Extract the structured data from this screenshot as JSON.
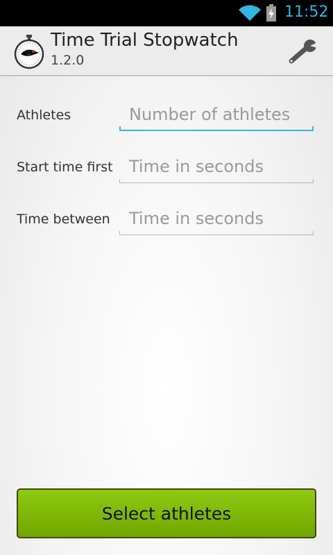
{
  "status_bar": {
    "time": "11:52",
    "icons": [
      "wifi-icon",
      "battery-charging-icon"
    ],
    "clock_color": "#33b5e5"
  },
  "action_bar": {
    "title": "Time Trial Stopwatch",
    "version": "1.2.0",
    "app_icon": "stopwatch-icon",
    "settings_icon": "wrench-icon"
  },
  "form": {
    "athletes": {
      "label": "Athletes",
      "placeholder": "Number of athletes",
      "value": ""
    },
    "start_time_first": {
      "label": "Start time first",
      "placeholder": "Time in seconds",
      "value": ""
    },
    "time_between": {
      "label": "Time between",
      "placeholder": "Time in seconds",
      "value": ""
    }
  },
  "button": {
    "label": "Select athletes",
    "color": "#7ab800"
  },
  "colors": {
    "accent": "#33b5e5"
  }
}
